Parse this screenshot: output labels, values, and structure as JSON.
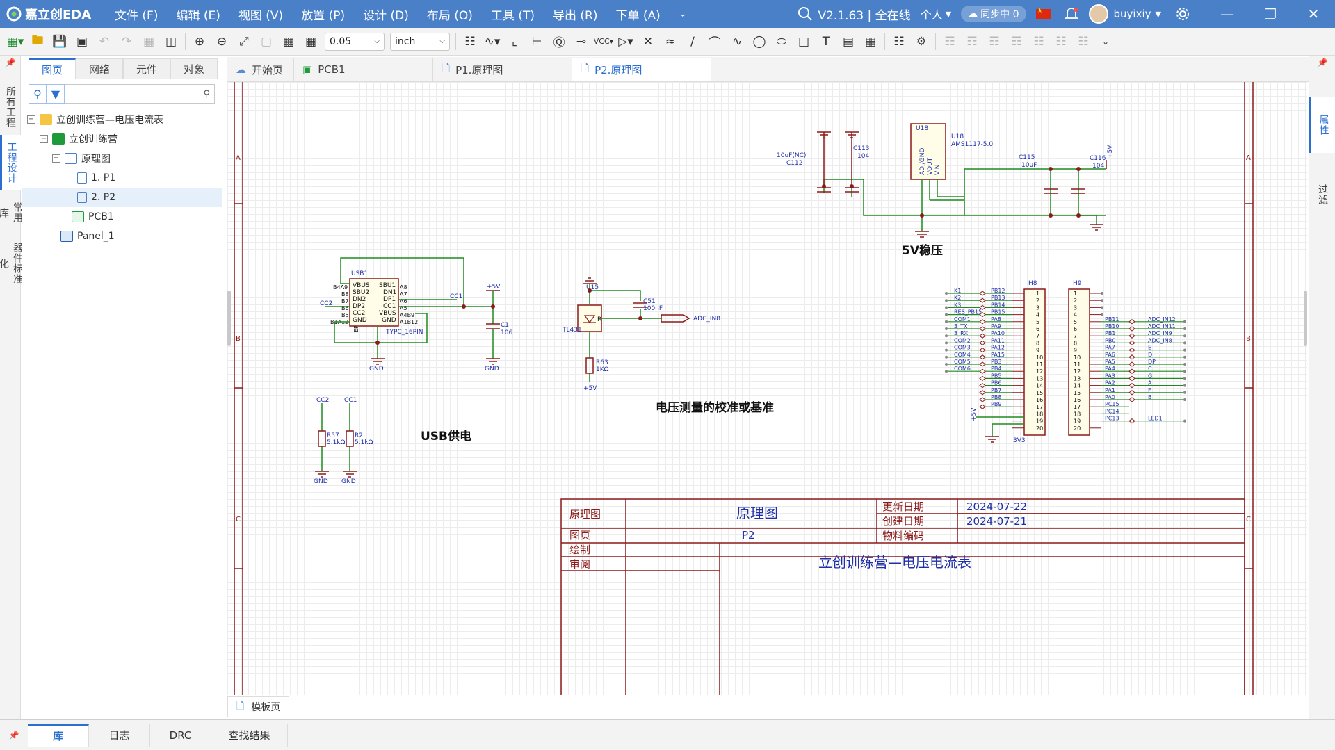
{
  "app": {
    "logo_text": "嘉立创EDA",
    "menu": [
      "文件 (F)",
      "编辑 (E)",
      "视图 (V)",
      "放置 (P)",
      "设计 (D)",
      "布局 (O)",
      "工具 (T)",
      "导出 (R)",
      "下单 (A)"
    ],
    "version": "V2.1.63 | 全在线",
    "account": "个人",
    "sync": "同步中 0",
    "user": "buyixiy"
  },
  "toolbar": {
    "grid": "0.05",
    "unit": "inch"
  },
  "left_strip": [
    "所有工程",
    "工程设计",
    "常用库",
    "器件标准化"
  ],
  "panel": {
    "tabs": [
      "图页",
      "网络",
      "元件",
      "对象"
    ],
    "tree": [
      {
        "label": "立创训练营—电压电流表",
        "level": 0
      },
      {
        "label": "立创训练营",
        "level": 1
      },
      {
        "label": "原理图",
        "level": 2
      },
      {
        "label": "1. P1",
        "level": 3
      },
      {
        "label": "2. P2",
        "level": 3
      },
      {
        "label": "PCB1",
        "level": 2
      },
      {
        "label": "Panel_1",
        "level": 1
      }
    ]
  },
  "right_strip": [
    "属性",
    "过滤"
  ],
  "doc_tabs": [
    "开始页",
    "PCB1",
    "P1.原理图",
    "P2.原理图"
  ],
  "template_tab": "模板页",
  "bottom_tabs": [
    "库",
    "日志",
    "DRC",
    "查找结果"
  ],
  "schematic": {
    "border_rows": [
      "A",
      "B",
      "C"
    ],
    "sections": {
      "regulator": "5V稳压",
      "usb": "USB供电",
      "reference": "电压测量的校准或基准"
    },
    "u18": {
      "ref": "U18",
      "value": "AMS1117-5.0",
      "pins": [
        "ADJ/GND",
        "VOUT",
        "VIN"
      ]
    },
    "caps": {
      "c112": {
        "ref": "C112",
        "value": "10uF(NC)"
      },
      "c113": {
        "ref": "C113",
        "value": "104"
      },
      "c115": {
        "ref": "C115",
        "value": "10uF"
      },
      "c116": {
        "ref": "C116",
        "value": "104"
      },
      "c1": {
        "ref": "C1",
        "value": "106"
      },
      "c51": {
        "ref": "C51",
        "value": "100nF"
      }
    },
    "usb1": {
      "ref": "USB1",
      "value": "TYPC_16PIN",
      "left_pins": [
        "VBUS",
        "SBU2",
        "DN2",
        "DP2",
        "CC2",
        "GND"
      ],
      "right_pins": [
        "SBU1",
        "DN1",
        "DP1",
        "CC1",
        "VBUS",
        "GND"
      ],
      "left_nums": [
        "B4A9",
        "B8",
        "B7",
        "B6",
        "B5",
        "B1A12"
      ],
      "right_nums": [
        "A8",
        "A7",
        "A6",
        "A5",
        "A4B9",
        "A1B12"
      ]
    },
    "u15": {
      "ref": "U15",
      "value": "TL431"
    },
    "r63": {
      "ref": "R63",
      "value": "1KΩ"
    },
    "r57": {
      "ref": "R57",
      "value": "5.1kΩ"
    },
    "r2": {
      "ref": "R2",
      "value": "5.1kΩ"
    },
    "nets": {
      "gnd": "GND",
      "p5v": "+5V",
      "cc1": "CC1",
      "cc2": "CC2",
      "adc": "ADC_IN8",
      "v33": "3V3"
    },
    "h8": {
      "ref": "H8",
      "left_nets": [
        "K1",
        "K2",
        "K3",
        "RES_PB15",
        "COM1",
        "3_TX",
        "3_RX",
        "COM2",
        "COM3",
        "COM4",
        "COM5",
        "COM6"
      ],
      "pin_labels": [
        "PB12",
        "PB13",
        "PB14",
        "PB15",
        "PA8",
        "PA9",
        "PA10",
        "PA11",
        "PA12",
        "PA15",
        "PB3",
        "PB4",
        "PB5",
        "PB6",
        "PB7",
        "PB8",
        "PB9"
      ]
    },
    "h9": {
      "ref": "H9",
      "pin_labels": [
        "PB11",
        "PB10",
        "PB1",
        "PB0",
        "PA7",
        "PA6",
        "PA5",
        "PA4",
        "PA3",
        "PA2",
        "PA1",
        "PA0",
        "PC15",
        "PC14",
        "PC13"
      ],
      "right_nets": [
        "ADC_IN12",
        "ADC_IN11",
        "ADC_IN9",
        "ADC_IN8",
        "E",
        "D",
        "DP",
        "C",
        "G",
        "A",
        "F",
        "B",
        "",
        "",
        "LED1"
      ]
    },
    "title_block": {
      "label_schematic": "原理图",
      "title": "原理图",
      "label_updated": "更新日期",
      "updated": "2024-07-22",
      "label_created": "创建日期",
      "created": "2024-07-21",
      "label_page": "图页",
      "page": "P2",
      "label_material": "物料编码",
      "label_drawn": "绘制",
      "label_review": "审阅",
      "project": "立创训练营—电压电流表"
    }
  }
}
